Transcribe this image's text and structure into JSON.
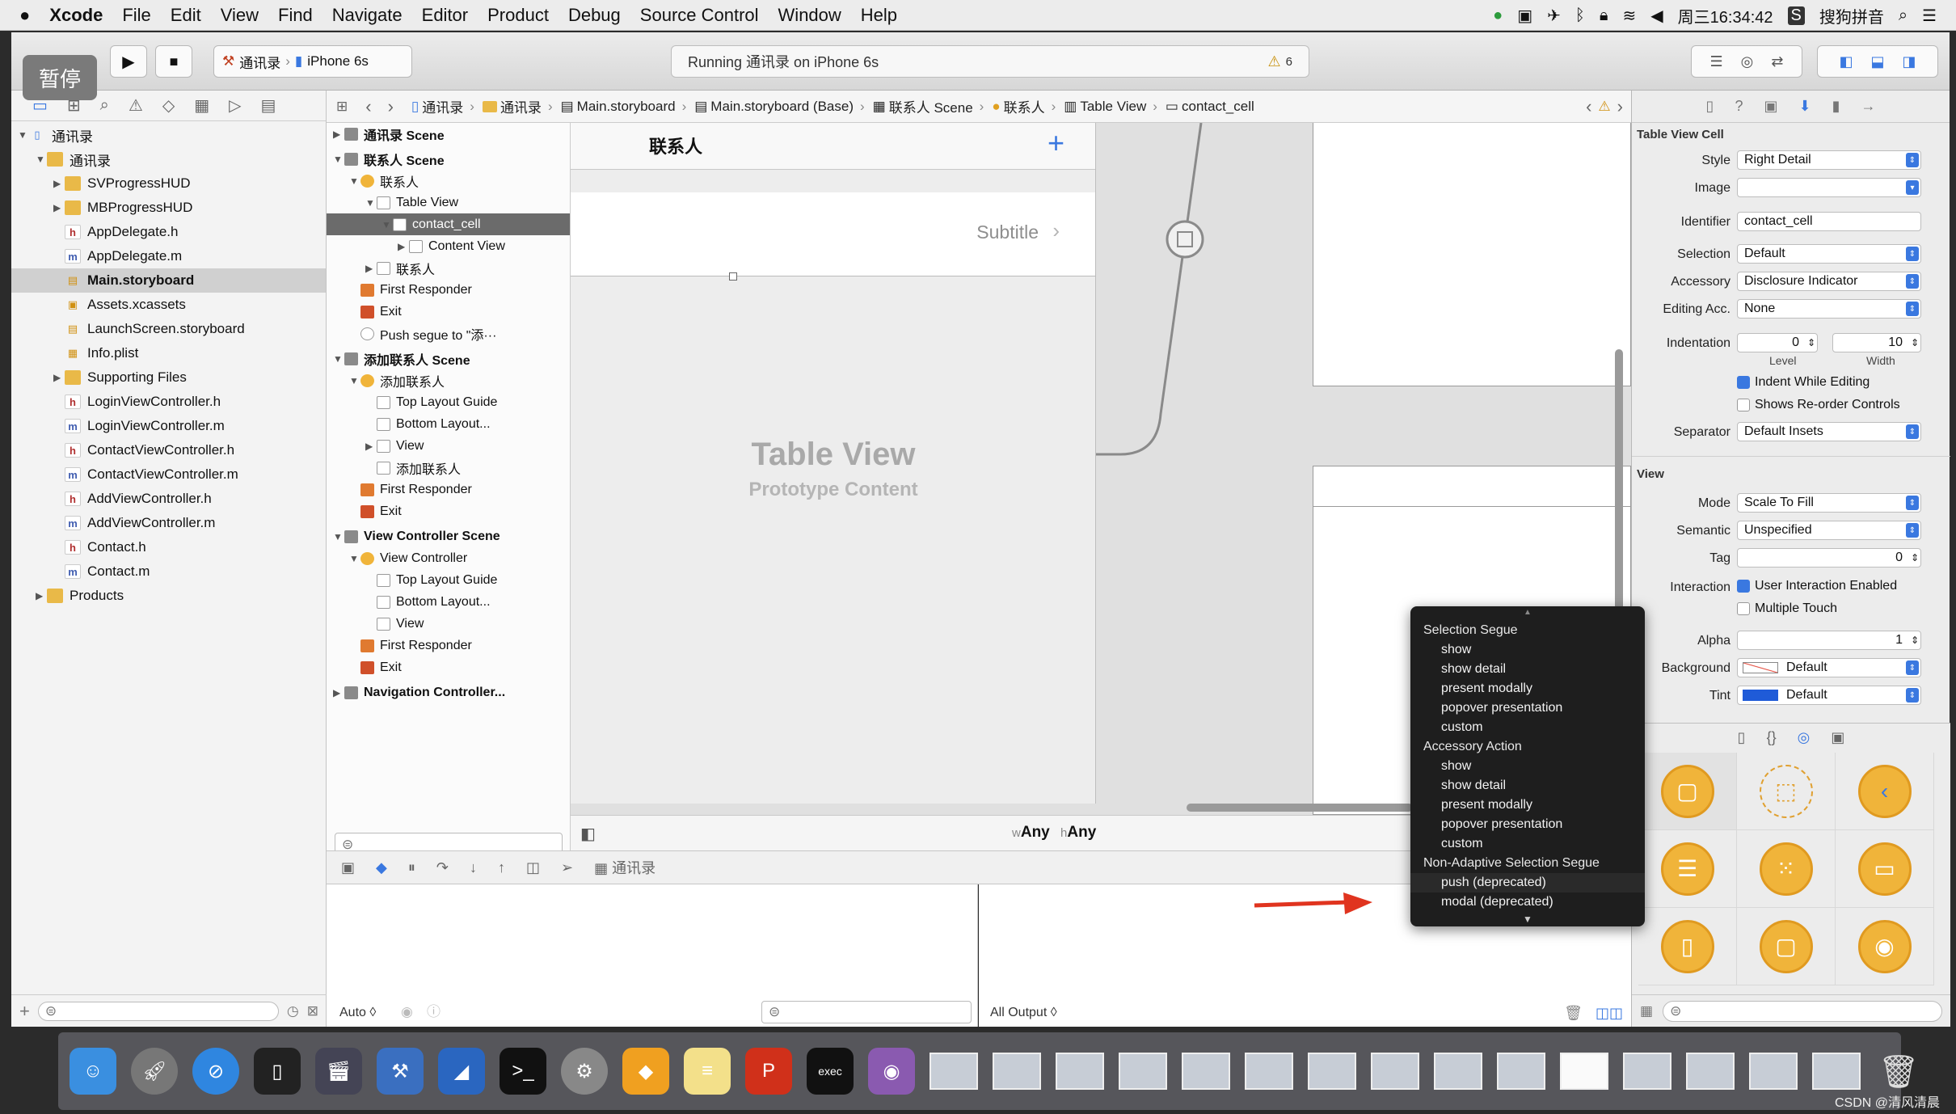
{
  "menubar": {
    "apple": "",
    "items": [
      "Xcode",
      "File",
      "Edit",
      "View",
      "Find",
      "Navigate",
      "Editor",
      "Product",
      "Debug",
      "Source Control",
      "Window",
      "Help"
    ],
    "clock": "周三16:34:42",
    "ime": "搜狗拼音"
  },
  "toolbar": {
    "scheme": "通讯录",
    "device": "iPhone 6s",
    "status": "Running 通讯录 on iPhone 6s",
    "warning_count": "6"
  },
  "overlay": {
    "pause_label": "暂停"
  },
  "navigator": {
    "items": [
      {
        "label": "通讯录",
        "depth": 0,
        "type": "project",
        "expanded": true
      },
      {
        "label": "通讯录",
        "depth": 1,
        "type": "folder",
        "expanded": true
      },
      {
        "label": "SVProgressHUD",
        "depth": 2,
        "type": "folder"
      },
      {
        "label": "MBProgressHUD",
        "depth": 2,
        "type": "folder"
      },
      {
        "label": "AppDelegate.h",
        "depth": 2,
        "type": "h"
      },
      {
        "label": "AppDelegate.m",
        "depth": 2,
        "type": "m"
      },
      {
        "label": "Main.storyboard",
        "depth": 2,
        "type": "storyboard",
        "selected": true
      },
      {
        "label": "Assets.xcassets",
        "depth": 2,
        "type": "assets"
      },
      {
        "label": "LaunchScreen.storyboard",
        "depth": 2,
        "type": "storyboard"
      },
      {
        "label": "Info.plist",
        "depth": 2,
        "type": "plist"
      },
      {
        "label": "Supporting Files",
        "depth": 2,
        "type": "folder"
      },
      {
        "label": "LoginViewController.h",
        "depth": 2,
        "type": "h"
      },
      {
        "label": "LoginViewController.m",
        "depth": 2,
        "type": "m"
      },
      {
        "label": "ContactViewController.h",
        "depth": 2,
        "type": "h"
      },
      {
        "label": "ContactViewController.m",
        "depth": 2,
        "type": "m"
      },
      {
        "label": "AddViewController.h",
        "depth": 2,
        "type": "h"
      },
      {
        "label": "AddViewController.m",
        "depth": 2,
        "type": "m"
      },
      {
        "label": "Contact.h",
        "depth": 2,
        "type": "h"
      },
      {
        "label": "Contact.m",
        "depth": 2,
        "type": "m"
      },
      {
        "label": "Products",
        "depth": 1,
        "type": "folder"
      }
    ]
  },
  "jumpbar": {
    "crumbs": [
      "通讯录",
      "通讯录",
      "Main.storyboard",
      "Main.storyboard (Base)",
      "联系人 Scene",
      "联系人",
      "Table View",
      "contact_cell"
    ]
  },
  "outline": {
    "rows": [
      {
        "label": "通讯录 Scene",
        "depth": 0,
        "header": true
      },
      {
        "label": "联系人 Scene",
        "depth": 0,
        "header": true
      },
      {
        "label": "联系人",
        "depth": 1
      },
      {
        "label": "Table View",
        "depth": 2
      },
      {
        "label": "contact_cell",
        "depth": 3,
        "selected": true
      },
      {
        "label": "Content View",
        "depth": 4
      },
      {
        "label": "联系人",
        "depth": 2
      },
      {
        "label": "First Responder",
        "depth": 1
      },
      {
        "label": "Exit",
        "depth": 1
      },
      {
        "label": "Push segue to \"添···",
        "depth": 1
      },
      {
        "label": "添加联系人 Scene",
        "depth": 0,
        "header": true
      },
      {
        "label": "添加联系人",
        "depth": 1
      },
      {
        "label": "Top Layout Guide",
        "depth": 2
      },
      {
        "label": "Bottom Layout...",
        "depth": 2
      },
      {
        "label": "View",
        "depth": 2
      },
      {
        "label": "添加联系人",
        "depth": 2
      },
      {
        "label": "First Responder",
        "depth": 1
      },
      {
        "label": "Exit",
        "depth": 1
      },
      {
        "label": "View Controller Scene",
        "depth": 0,
        "header": true
      },
      {
        "label": "View Controller",
        "depth": 1
      },
      {
        "label": "Top Layout Guide",
        "depth": 2
      },
      {
        "label": "Bottom Layout...",
        "depth": 2
      },
      {
        "label": "View",
        "depth": 2
      },
      {
        "label": "First Responder",
        "depth": 1
      },
      {
        "label": "Exit",
        "depth": 1
      },
      {
        "label": "Navigation Controller...",
        "depth": 0,
        "header": true
      }
    ]
  },
  "canvas": {
    "nav_title": "联系人",
    "add_glyph": "+",
    "cell_detail": "Subtitle",
    "tv_title": "Table View",
    "tv_subtitle": "Prototype Content",
    "size_class_w": "w",
    "size_class_wv": "Any",
    "size_class_h": "h",
    "size_class_hv": "Any"
  },
  "debugbar": {
    "target": "通讯录"
  },
  "console": {
    "auto_label": "Auto ◊",
    "output_label": "All Output ◊"
  },
  "inspector": {
    "section_cell": "Table View Cell",
    "style_label": "Style",
    "style_value": "Right Detail",
    "image_label": "Image",
    "image_value": "",
    "identifier_label": "Identifier",
    "identifier_value": "contact_cell",
    "selection_label": "Selection",
    "selection_value": "Default",
    "accessory_label": "Accessory",
    "accessory_value": "Disclosure Indicator",
    "editing_label": "Editing Acc.",
    "editing_value": "None",
    "indent_label": "Indentation",
    "indent_level": "0",
    "indent_width": "10",
    "level_caption": "Level",
    "width_caption": "Width",
    "indent_while_editing": "Indent While Editing",
    "shows_reorder": "Shows Re-order Controls",
    "separator_label": "Separator",
    "separator_value": "Default Insets",
    "section_view": "View",
    "mode_label": "Mode",
    "mode_value": "Scale To Fill",
    "semantic_label": "Semantic",
    "semantic_value": "Unspecified",
    "tag_label": "Tag",
    "tag_value": "0",
    "interaction_label": "Interaction",
    "user_interaction": "User Interaction Enabled",
    "multiple_touch": "Multiple Touch",
    "alpha_label": "Alpha",
    "alpha_value": "1",
    "background_label": "Background",
    "background_value": "Default",
    "tint_label": "Tint",
    "tint_value": "Default"
  },
  "segue_popup": {
    "groups": [
      {
        "title": "Selection Segue",
        "items": [
          "show",
          "show detail",
          "present modally",
          "popover presentation",
          "custom"
        ]
      },
      {
        "title": "Accessory Action",
        "items": [
          "show",
          "show detail",
          "present modally",
          "popover presentation",
          "custom"
        ]
      },
      {
        "title": "Non-Adaptive Selection Segue",
        "items": [
          "push (deprecated)",
          "modal (deprecated)"
        ]
      }
    ]
  },
  "watermark": "CSDN @清风清晨",
  "colors": {
    "accent": "#3a78e0",
    "arrow": "#e0341f",
    "lib_orange": "#f0b43a"
  }
}
